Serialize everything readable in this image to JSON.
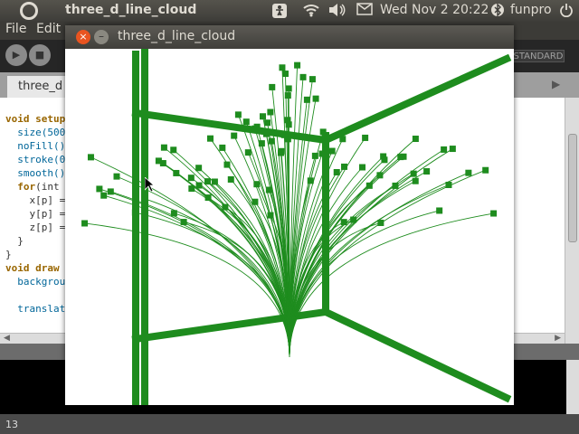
{
  "top_panel": {
    "app_title": "three_d_line_cloud",
    "clock": "Wed Nov  2 20:22",
    "user": "funpro"
  },
  "ide": {
    "menu": {
      "file": "File",
      "edit": "Edit"
    },
    "mode": "STANDARD",
    "tab_label": "three_d",
    "code_lines": [
      {
        "parts": [
          {
            "t": "void ",
            "c": "kw"
          },
          {
            "t": "setup",
            "c": "kw"
          }
        ]
      },
      {
        "parts": [
          {
            "t": "  size(500",
            "c": "fn"
          }
        ]
      },
      {
        "parts": [
          {
            "t": "  noFill()",
            "c": "fn"
          }
        ]
      },
      {
        "parts": [
          {
            "t": "  stroke(0",
            "c": "fn"
          }
        ]
      },
      {
        "parts": [
          {
            "t": "  smooth()",
            "c": "fn"
          }
        ]
      },
      {
        "parts": [
          {
            "t": "  for",
            "c": "kw"
          },
          {
            "t": "(int",
            "c": ""
          }
        ]
      },
      {
        "parts": [
          {
            "t": "    x[p] =",
            "c": ""
          }
        ]
      },
      {
        "parts": [
          {
            "t": "    y[p] =",
            "c": ""
          }
        ]
      },
      {
        "parts": [
          {
            "t": "    z[p] =",
            "c": ""
          }
        ]
      },
      {
        "parts": [
          {
            "t": "  }",
            "c": ""
          }
        ]
      },
      {
        "parts": [
          {
            "t": "}",
            "c": ""
          }
        ]
      },
      {
        "parts": [
          {
            "t": "void ",
            "c": "kw"
          },
          {
            "t": "draw",
            "c": "kw"
          }
        ]
      },
      {
        "parts": [
          {
            "t": "  backgrou",
            "c": "fn"
          }
        ]
      },
      {
        "parts": [
          {
            "t": "",
            "c": ""
          }
        ]
      },
      {
        "parts": [
          {
            "t": "  translat",
            "c": "fn"
          }
        ]
      }
    ],
    "status_line": "13"
  },
  "sketch_window": {
    "title": "three_d_line_cloud",
    "close_symbol": "×",
    "minimize_symbol": "–"
  },
  "icons": {
    "ubuntu": "ubuntu-logo-icon",
    "accessibility": "accessibility-icon",
    "wifi": "wifi-icon",
    "volume": "volume-icon",
    "mail": "mail-icon",
    "bluetooth": "bluetooth-icon",
    "power": "power-icon"
  },
  "colors": {
    "accent_green": "#1e8c1e",
    "close_orange": "#e95420"
  }
}
